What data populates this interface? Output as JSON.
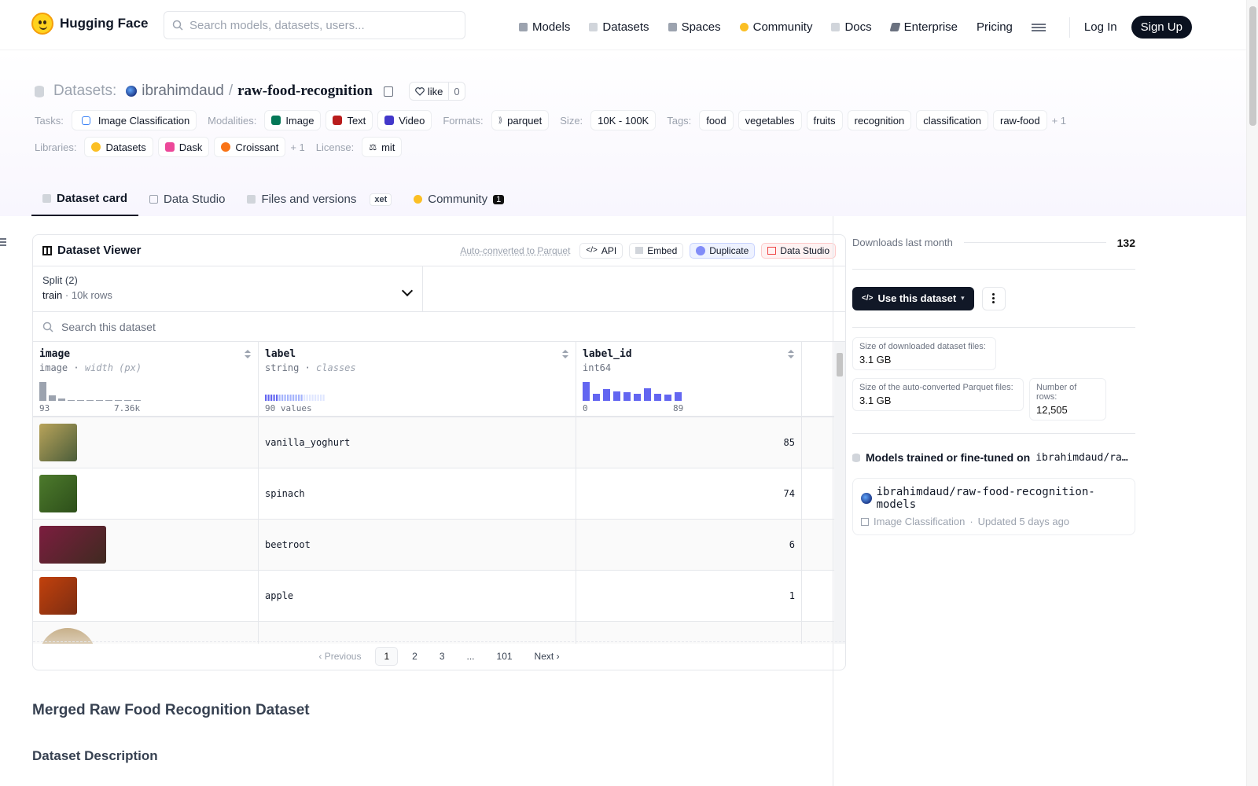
{
  "header": {
    "brand": "Hugging Face",
    "search_placeholder": "Search models, datasets, users...",
    "nav": [
      {
        "label": "Models",
        "color": "#9ca3af"
      },
      {
        "label": "Datasets",
        "color": "#d1d5db"
      },
      {
        "label": "Spaces",
        "color": "#9ca3af"
      },
      {
        "label": "Community",
        "color": "#fbbf24"
      },
      {
        "label": "Docs",
        "color": "#d1d5db"
      },
      {
        "label": "Enterprise",
        "color": "#6b7280"
      },
      {
        "label": "Pricing",
        "color": ""
      }
    ],
    "login": "Log In",
    "signup": "Sign Up"
  },
  "repo": {
    "crumb": "Datasets:",
    "owner": "ibrahimdaud",
    "sep": "/",
    "name": "raw-food-recognition",
    "like_label": "like",
    "like_count": "0"
  },
  "meta": {
    "tasks_label": "Tasks:",
    "task": "Image Classification",
    "modalities_label": "Modalities:",
    "modalities": [
      {
        "label": "Image",
        "color": "#047857"
      },
      {
        "label": "Text",
        "color": "#b91c1c"
      },
      {
        "label": "Video",
        "color": "#4338ca"
      }
    ],
    "formats_label": "Formats:",
    "format": "parquet",
    "size_label": "Size:",
    "size": "10K - 100K",
    "tags_label": "Tags:",
    "tags": [
      "food",
      "vegetables",
      "fruits",
      "recognition",
      "classification",
      "raw-food"
    ],
    "tags_more": "+ 1",
    "libraries_label": "Libraries:",
    "libraries": [
      {
        "label": "Datasets",
        "color": "#fbbf24"
      },
      {
        "label": "Dask",
        "color": "#ec4899"
      },
      {
        "label": "Croissant",
        "color": "#f97316"
      }
    ],
    "libraries_more": "+ 1",
    "license_label": "License:",
    "license": "mit"
  },
  "tabs": [
    {
      "label": "Dataset card",
      "active": true
    },
    {
      "label": "Data Studio"
    },
    {
      "label": "Files and versions",
      "extra": "xet"
    },
    {
      "label": "Community",
      "badge": "1"
    }
  ],
  "viewer": {
    "title": "Dataset Viewer",
    "auto": "Auto-converted to Parquet",
    "buttons": [
      "API",
      "Embed",
      "Duplicate",
      "Data Studio"
    ],
    "split_title": "Split (2)",
    "split_value": "train",
    "split_rows": "10k rows",
    "search_placeholder": "Search this dataset",
    "columns": [
      {
        "name": "image",
        "type": "image",
        "sub": "width (px)",
        "min": "93",
        "max": "7.36k"
      },
      {
        "name": "label",
        "type": "string",
        "sub": "classes",
        "summary": "90 values"
      },
      {
        "name": "label_id",
        "type": "int64",
        "sub": "",
        "min": "0",
        "max": "89"
      }
    ],
    "rows": [
      {
        "label": "vanilla_yoghurt",
        "label_id": "85",
        "colors": [
          "#b8a35a",
          "#4b5d3a"
        ]
      },
      {
        "label": "spinach",
        "label_id": "74",
        "colors": [
          "#4d7a2c",
          "#2d4f1a"
        ]
      },
      {
        "label": "beetroot",
        "label_id": "6",
        "colors": [
          "#7c1d3f",
          "#3f2a20"
        ]
      },
      {
        "label": "apple",
        "label_id": "1",
        "colors": [
          "#c2410c",
          "#7c2d12"
        ]
      },
      {
        "label": "",
        "label_id": "",
        "colors": [
          "#c8b08a",
          "#f5f5f4"
        ]
      }
    ],
    "pager": [
      "Previous",
      "1",
      "2",
      "3",
      "...",
      "101",
      "Next"
    ]
  },
  "card": {
    "h1": "Merged Raw Food Recognition Dataset",
    "h2": "Dataset Description"
  },
  "sidebar": {
    "downloads_label": "Downloads last month",
    "downloads": "132",
    "use_button": "Use this dataset",
    "size_files_label": "Size of downloaded dataset files:",
    "size_files": "3.1 GB",
    "size_parquet_label": "Size of the auto-converted Parquet files:",
    "size_parquet": "3.1 GB",
    "num_rows_label": "Number of rows:",
    "num_rows": "12,505",
    "models_heading": "Models trained or fine-tuned on",
    "models_repo": "ibrahimdaud/ra…",
    "model_name": "ibrahimdaud/raw-food-recognition-models",
    "model_task": "Image Classification",
    "model_updated": "Updated 5 days ago"
  }
}
